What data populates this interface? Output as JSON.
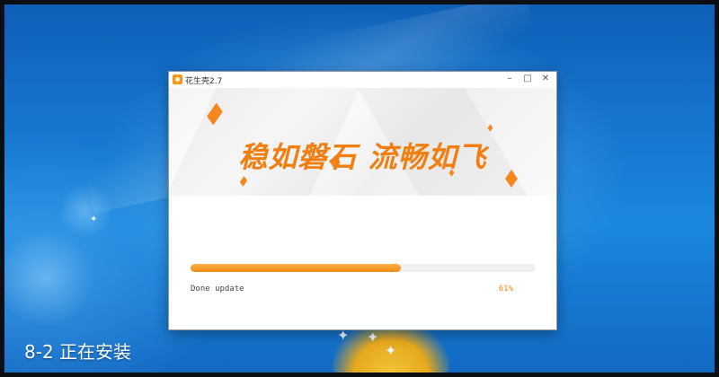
{
  "window": {
    "title": "花生壳2.7",
    "controls": {
      "minimize": "–",
      "maximize": "□",
      "close": "✕"
    },
    "banner_slogan": "稳如磐石 流畅如飞",
    "progress": {
      "status": "Done update",
      "percent_label": "61%",
      "fraction": 0.61
    }
  },
  "caption": "8-2 正在安装",
  "colors": {
    "accent": "#f07f12",
    "desktop": "#1677cf"
  },
  "icons": [
    "app-icon",
    "minimize-icon",
    "maximize-icon",
    "close-icon"
  ]
}
